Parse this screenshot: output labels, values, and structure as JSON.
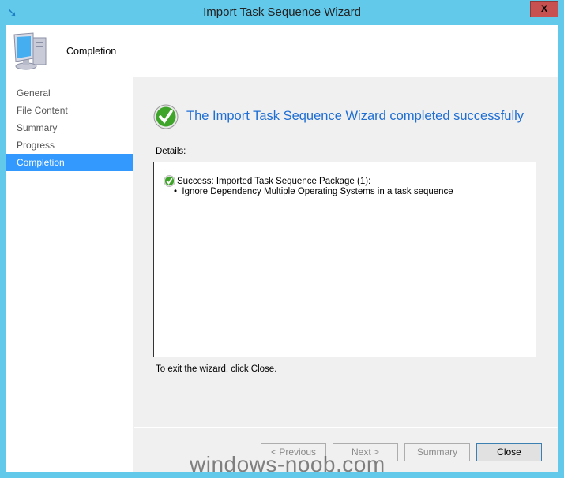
{
  "window": {
    "title": "Import Task Sequence Wizard",
    "close_label": "X"
  },
  "header": {
    "title": "Completion"
  },
  "sidebar": {
    "items": [
      {
        "label": "General"
      },
      {
        "label": "File Content"
      },
      {
        "label": "Summary"
      },
      {
        "label": "Progress"
      },
      {
        "label": "Completion",
        "active": true
      }
    ]
  },
  "main": {
    "success_title": "The Import Task Sequence Wizard completed successfully",
    "details_label": "Details:",
    "details": {
      "line1": "Success: Imported Task Sequence Package (1):",
      "bullet": "•",
      "line2": "Ignore Dependency Multiple Operating Systems in a task sequence"
    },
    "exit_hint": "To exit the wizard, click Close."
  },
  "buttons": {
    "previous": "< Previous",
    "next": "Next >",
    "summary": "Summary",
    "close": "Close"
  },
  "watermark": "windows-noob.com",
  "colors": {
    "frame": "#63c9ea",
    "accent": "#3399ff",
    "title_text": "#1e6ed4",
    "close_button": "#c75050"
  }
}
